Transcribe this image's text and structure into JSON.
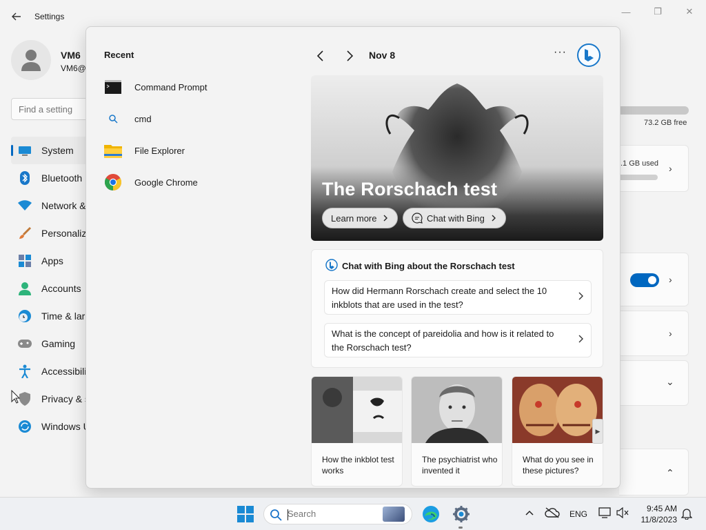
{
  "window": {
    "title": "Settings",
    "controls": {
      "minimize": "—",
      "restore": "❐",
      "close": "✕"
    }
  },
  "user": {
    "name": "VM6",
    "email": "VM6@"
  },
  "search": {
    "placeholder": "Find a setting"
  },
  "sidebar": {
    "items": [
      {
        "label": "System",
        "icon": "system-icon",
        "active": true
      },
      {
        "label": "Bluetooth",
        "icon": "bluetooth-icon"
      },
      {
        "label": "Network &",
        "icon": "wifi-icon"
      },
      {
        "label": "Personaliz",
        "icon": "brush-icon"
      },
      {
        "label": "Apps",
        "icon": "apps-icon"
      },
      {
        "label": "Accounts",
        "icon": "accounts-icon"
      },
      {
        "label": "Time & lar",
        "icon": "clock-icon"
      },
      {
        "label": "Gaming",
        "icon": "controller-icon"
      },
      {
        "label": "Accessibili",
        "icon": "accessibility-icon"
      },
      {
        "label": "Privacy & s",
        "icon": "shield-icon"
      },
      {
        "label": "Windows U",
        "icon": "update-icon"
      }
    ]
  },
  "background": {
    "storage_free": "73.2 GB free",
    "storage_used": ".1 GB used"
  },
  "flyout": {
    "recent_title": "Recent",
    "recent": [
      {
        "label": "Command Prompt",
        "icon": "command-prompt-icon"
      },
      {
        "label": "cmd",
        "icon": "search-icon"
      },
      {
        "label": "File Explorer",
        "icon": "folder-icon"
      },
      {
        "label": "Google Chrome",
        "icon": "chrome-icon"
      }
    ],
    "date": "Nov 8",
    "more": "···",
    "hero": {
      "title": "The Rorschach test",
      "learn_more": "Learn more",
      "chat_with_bing": "Chat with Bing"
    },
    "chat": {
      "title": "Chat with Bing about the Rorschach test",
      "questions": [
        "How did Hermann Rorschach create and select the 10 inkblots that are used in the test?",
        "What is the concept of pareidolia and how is it related to the Rorschach test?"
      ]
    },
    "tiles": [
      {
        "caption": "How the inkblot test works"
      },
      {
        "caption": "The psychiatrist who invented it"
      },
      {
        "caption": "What do you see in these pictures?"
      }
    ]
  },
  "taskbar": {
    "search_placeholder": "Search",
    "language": "ENG",
    "time": "9:45 AM",
    "date": "11/8/2023"
  },
  "colors": {
    "accent": "#0067c0",
    "bing": "#1877c9"
  }
}
